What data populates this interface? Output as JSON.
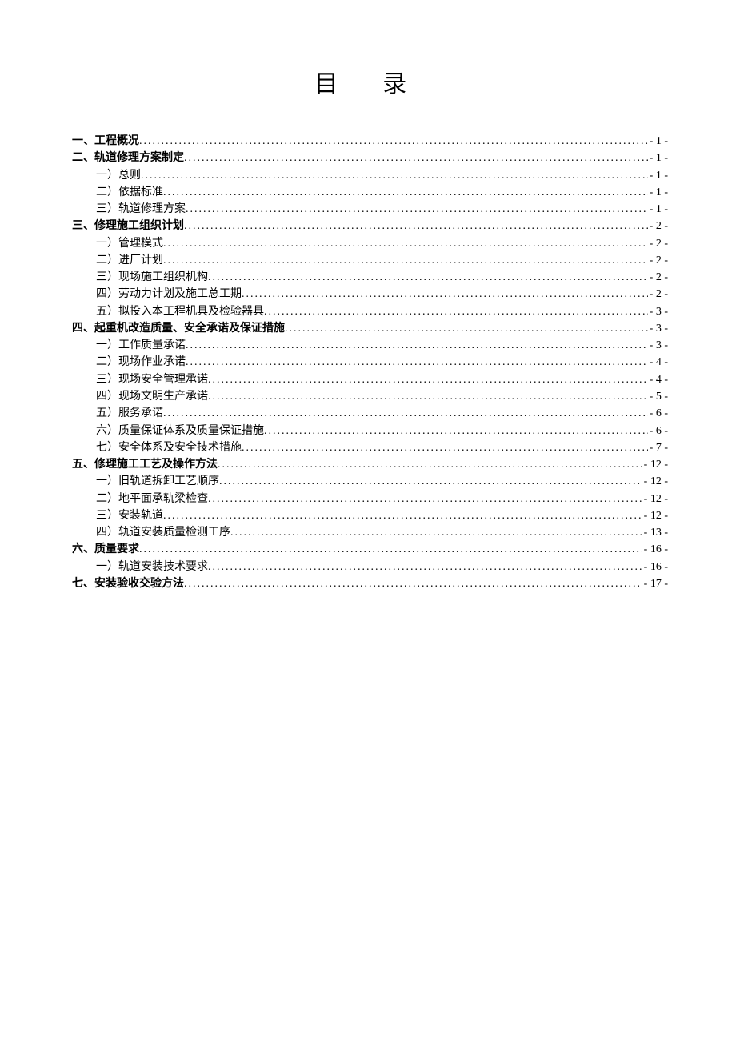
{
  "title": "目 录",
  "entries": [
    {
      "level": 0,
      "label": "一、工程概况",
      "page": "- 1 -"
    },
    {
      "level": 0,
      "label": "二、轨道修理方案制定",
      "page": "- 1 -"
    },
    {
      "level": 1,
      "label": "一）总则",
      "page": "- 1 -"
    },
    {
      "level": 1,
      "label": "二）依据标准",
      "page": "- 1 -"
    },
    {
      "level": 1,
      "label": "三）轨道修理方案",
      "page": "- 1 -"
    },
    {
      "level": 0,
      "label": "三、修理施工组织计划",
      "page": "- 2 -"
    },
    {
      "level": 1,
      "label": "一）管理模式",
      "page": "- 2 -"
    },
    {
      "level": 1,
      "label": "二）进厂计划",
      "page": "- 2 -"
    },
    {
      "level": 1,
      "label": "三）现场施工组织机构",
      "page": "- 2 -"
    },
    {
      "level": 1,
      "label": "四）劳动力计划及施工总工期",
      "page": "- 2 -"
    },
    {
      "level": 1,
      "label": "五）拟投入本工程机具及检验器具",
      "page": "- 3 -"
    },
    {
      "level": 0,
      "label": "四、起重机改造质量、安全承诺及保证措施",
      "page": "- 3 -"
    },
    {
      "level": 1,
      "label": "一）工作质量承诺",
      "page": "- 3 -"
    },
    {
      "level": 1,
      "label": "二）现场作业承诺",
      "page": "- 4 -"
    },
    {
      "level": 1,
      "label": "三）现场安全管理承诺",
      "page": "- 4 -"
    },
    {
      "level": 1,
      "label": "四）现场文明生产承诺",
      "page": "- 5 -"
    },
    {
      "level": 1,
      "label": "五）服务承诺",
      "page": "- 6 -"
    },
    {
      "level": 1,
      "label": "六）质量保证体系及质量保证措施",
      "page": "- 6 -"
    },
    {
      "level": 1,
      "label": "七）安全体系及安全技术措施",
      "page": "- 7 -"
    },
    {
      "level": 0,
      "label": "五、修理施工工艺及操作方法",
      "page": "- 12 -"
    },
    {
      "level": 1,
      "label": "一）旧轨道拆卸工艺顺序",
      "page": "- 12 -"
    },
    {
      "level": 1,
      "label": "二）地平面承轨梁检查",
      "page": "- 12 -"
    },
    {
      "level": 1,
      "label": "三）安装轨道",
      "page": "- 12 -"
    },
    {
      "level": 1,
      "label": "四）轨道安装质量检测工序",
      "page": "- 13 -"
    },
    {
      "level": 0,
      "label": "六、质量要求",
      "page": "- 16 -"
    },
    {
      "level": 1,
      "label": "一）轨道安装技术要求",
      "page": "- 16 -"
    },
    {
      "level": 0,
      "label": "七、安装验收交验方法",
      "page": "- 17 -"
    }
  ]
}
